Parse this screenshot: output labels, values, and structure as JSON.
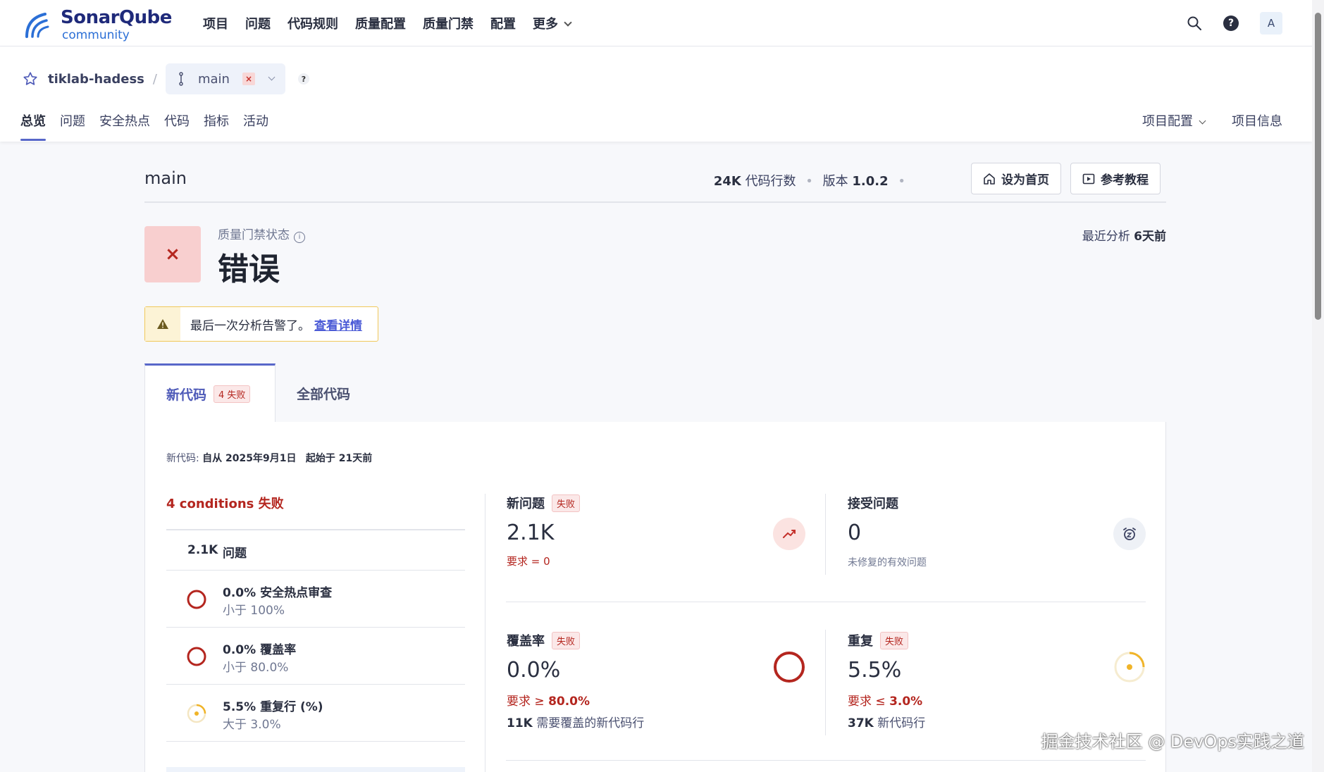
{
  "topnav": {
    "logo_text": "SonarQube",
    "logo_sub": "community",
    "menu": [
      "项目",
      "问题",
      "代码规则",
      "质量配置",
      "质量门禁",
      "配置",
      "更多"
    ],
    "avatar_letter": "A",
    "help_char": "?"
  },
  "project": {
    "name": "tiklab-hadess",
    "branch": "main",
    "branch_badge": "×",
    "help": "?",
    "tabs": [
      "总览",
      "问题",
      "安全热点",
      "代码",
      "指标",
      "活动"
    ],
    "right_tabs": [
      "项目配置",
      "项目信息"
    ]
  },
  "overview": {
    "branch_title": "main",
    "loc_value": "24K",
    "loc_label": "代码行数",
    "version_label": "版本",
    "version_value": "1.0.2",
    "set_home_button": "设为首页",
    "tutorial_button": "参考教程",
    "qg_label": "质量门禁状态",
    "qg_status": "错误",
    "qg_icon": "×",
    "last_analysis_label": "最近分析",
    "last_analysis_value": "6天前",
    "warning_text": "最后一次分析告警了。",
    "warning_link": "查看详情"
  },
  "tabs": {
    "new_code": "新代码",
    "new_code_badge": "4 失败",
    "all_code": "全部代码"
  },
  "newcode": {
    "prefix": "新代码:",
    "since": "自从 2025年9月1日",
    "started": "起始于 21天前"
  },
  "conditions": {
    "title": "4 conditions 失败",
    "rows": [
      {
        "num": "2.1K",
        "name": "问题"
      },
      {
        "main": "0.0% 安全热点审查",
        "sub": "小于 100%"
      },
      {
        "main": "0.0% 覆盖率",
        "sub": "小于 80.0%"
      },
      {
        "main": "5.5% 重复行 (%)",
        "sub": "大于 3.0%"
      }
    ]
  },
  "metrics": {
    "new_issues": {
      "label": "新问题",
      "badge": "失败",
      "value": "2.1K",
      "req": "要求 = 0"
    },
    "accepted": {
      "label": "接受问题",
      "value": "0",
      "sub": "未修复的有效问题"
    },
    "coverage": {
      "label": "覆盖率",
      "badge": "失败",
      "value": "0.0%",
      "req_prefix": "要求 ≥",
      "req_value": "80.0%",
      "sub_num": "11K",
      "sub_text": "需要覆盖的新代码行"
    },
    "duplication": {
      "label": "重复",
      "badge": "失败",
      "value": "5.5%",
      "req_prefix": "要求 ≤",
      "req_value": "3.0%",
      "sub_num": "37K",
      "sub_text": "新代码行"
    }
  },
  "watermark": "掘金技术社区 @ DevOps实践之道",
  "colors": {
    "accent": "#5867c9",
    "error": "#b4261f",
    "warning": "#f0c85a"
  }
}
